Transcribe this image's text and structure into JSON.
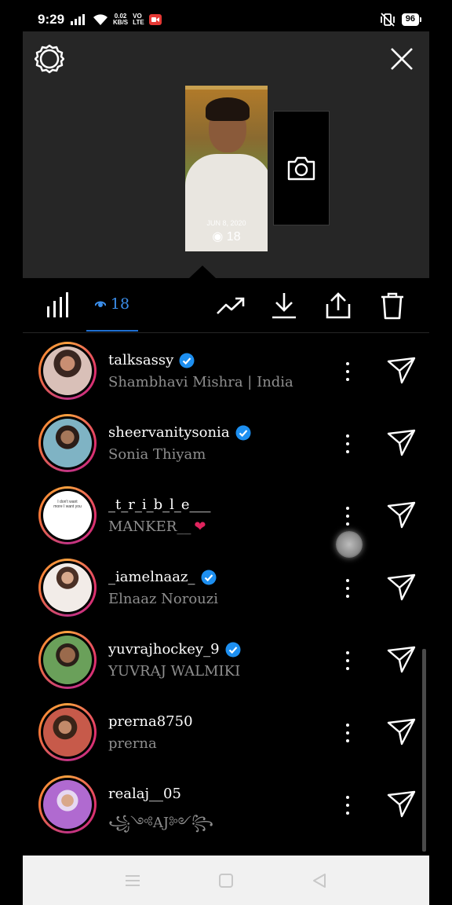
{
  "status_bar": {
    "time": "9:29",
    "speed_value": "0.02",
    "speed_unit": "KB/S",
    "volte_top": "VO",
    "volte_bottom": "LTE",
    "battery": "96"
  },
  "story": {
    "thumb_date": "JUN 8, 2020",
    "thumb_views": "18"
  },
  "toolbar": {
    "viewer_count": "18",
    "accent_color": "#3b8eea"
  },
  "viewers": [
    {
      "username": "talksassy",
      "full_name": "Shambhavi Mishra | India",
      "verified": true
    },
    {
      "username": "sheervanitysonia",
      "full_name": "Sonia Thiyam",
      "verified": true
    },
    {
      "username": "_t_r_i_b_l_e___",
      "full_name": "MANKER__",
      "verified": false,
      "name_suffix": "❤"
    },
    {
      "username": "_iamelnaaz_",
      "full_name": "Elnaaz Norouzi",
      "verified": true
    },
    {
      "username": "yuvrajhockey_9",
      "full_name": "YUVRAJ WALMIKI",
      "verified": true
    },
    {
      "username": "prerna8750",
      "full_name": "prerna",
      "verified": false
    },
    {
      "username": "realaj__05",
      "full_name": "꧁༺AJ༻꧂",
      "verified": false
    }
  ],
  "avatar1_text": "I don't want more I want you",
  "colors": {
    "verified_blue": "#1d8ff0",
    "panel_bg": "#262626",
    "muted_text": "#8e8e8e"
  }
}
